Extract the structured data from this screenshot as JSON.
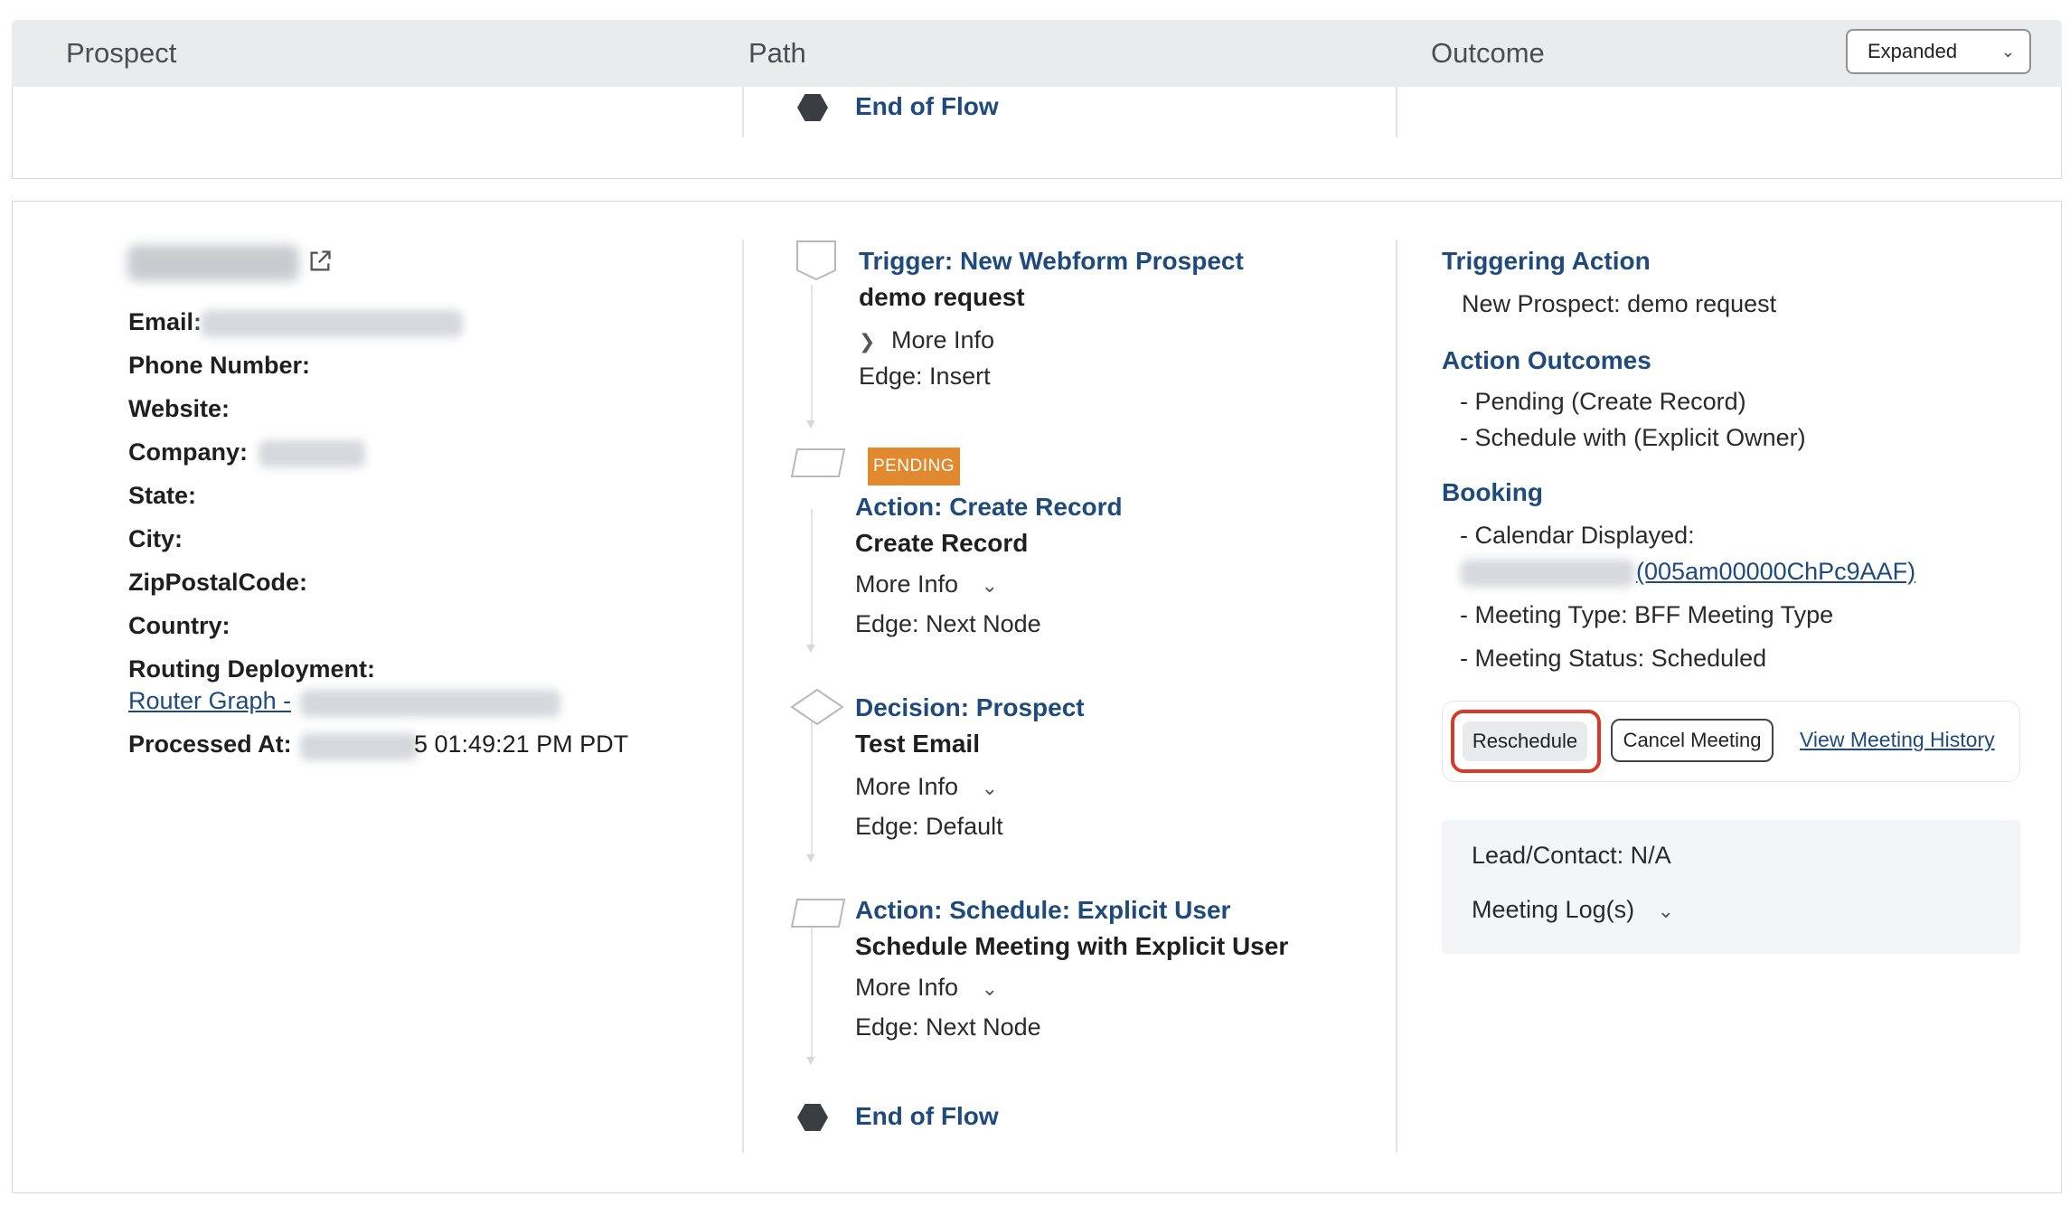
{
  "header": {
    "columns": [
      "Prospect",
      "Path",
      "Outcome"
    ],
    "view_select": {
      "value": "Expanded"
    }
  },
  "prev_row": {
    "end_of_flow": "End of Flow"
  },
  "prospect": {
    "fields": {
      "email": "Email:",
      "phone": "Phone Number:",
      "website": "Website:",
      "company": "Company:",
      "state": "State:",
      "city": "City:",
      "zip": "ZipPostalCode:",
      "country": "Country:",
      "routing": "Routing Deployment:",
      "processed": "Processed At:"
    },
    "router_link": "Router Graph -",
    "processed_time": "5 01:49:21 PM PDT"
  },
  "path": {
    "nodes": [
      {
        "title": "Trigger: New Webform Prospect",
        "subtitle": "demo request",
        "more_info": "More Info",
        "edge": "Edge: Insert"
      },
      {
        "badge": "PENDING",
        "title": "Action: Create Record",
        "subtitle": "Create Record",
        "more_info": "More Info",
        "edge": "Edge: Next Node"
      },
      {
        "title": "Decision: Prospect",
        "subtitle": "Test Email",
        "more_info": "More Info",
        "edge": "Edge: Default"
      },
      {
        "title": "Action: Schedule: Explicit User",
        "subtitle": "Schedule Meeting with Explicit User",
        "more_info": "More Info",
        "edge": "Edge: Next Node"
      }
    ],
    "end_of_flow": "End of Flow"
  },
  "outcome": {
    "triggering_action_heading": "Triggering Action",
    "triggering_action_value": "New Prospect: demo request",
    "action_outcomes_heading": "Action Outcomes",
    "action_outcomes": [
      "- Pending (Create Record)",
      "- Schedule with (Explicit Owner)"
    ],
    "booking_heading": "Booking",
    "calendar_label": "- Calendar Displayed:",
    "calendar_id": "(005am00000ChPc9AAF)",
    "meeting_type": "- Meeting Type: BFF Meeting Type",
    "meeting_status": "- Meeting Status: Scheduled",
    "buttons": {
      "reschedule": "Reschedule",
      "cancel": "Cancel Meeting",
      "history": "View Meeting History"
    },
    "lead_contact": "Lead/Contact: N/A",
    "meeting_logs": "Meeting Log(s)"
  },
  "colors": {
    "link": "#1f4a7c",
    "pending": "#e0892e",
    "focus": "#d8392b",
    "header_bg": "#eaebed"
  }
}
